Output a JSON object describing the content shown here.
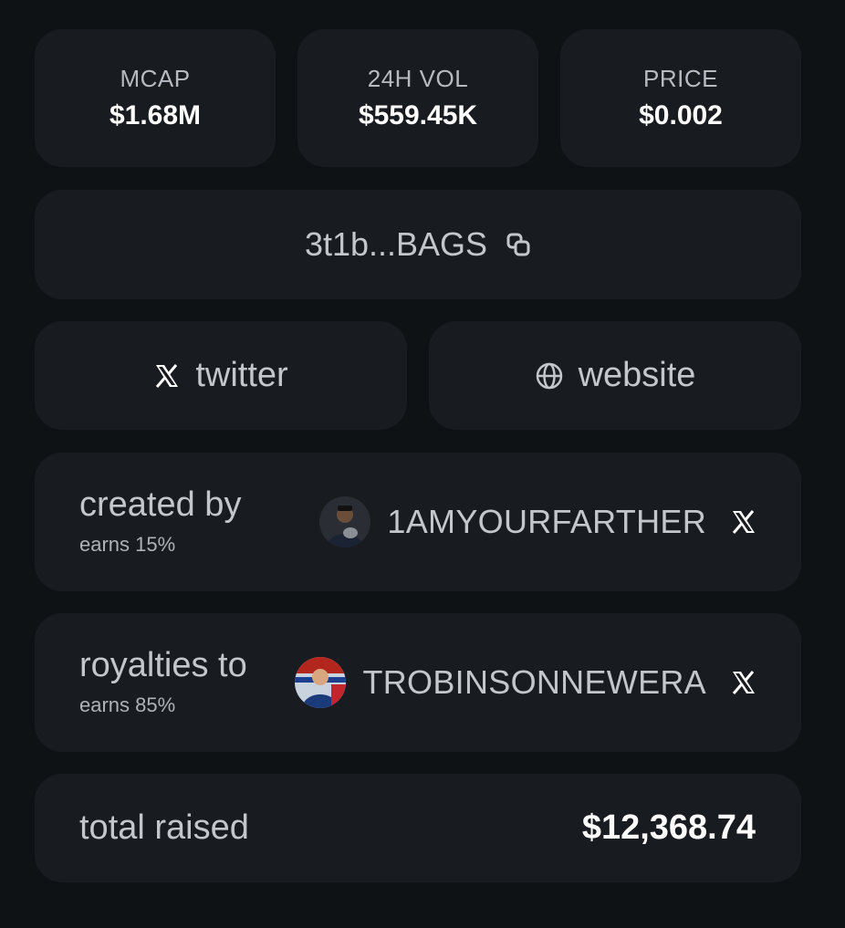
{
  "stats": [
    {
      "label": "MCAP",
      "value": "$1.68M"
    },
    {
      "label": "24H VOL",
      "value": "$559.45K"
    },
    {
      "label": "PRICE",
      "value": "$0.002"
    }
  ],
  "contract": {
    "address": "3t1b...BAGS",
    "icon": "copy-icon"
  },
  "links": {
    "twitter": {
      "label": "twitter",
      "icon": "x-logo-icon"
    },
    "website": {
      "label": "website",
      "icon": "globe-icon"
    }
  },
  "creator": {
    "title": "created by",
    "earns": "earns 15%",
    "handle": "1AMYOURFARTHER",
    "icon": "x-logo-icon"
  },
  "royalties": {
    "title": "royalties to",
    "earns": "earns 85%",
    "handle": "TROBINSONNEWERA",
    "icon": "x-logo-icon"
  },
  "total": {
    "label": "total raised",
    "value": "$12,368.74"
  },
  "colors": {
    "background": "#0f1215",
    "card": "#181b1f",
    "muted_text": "#c3c7cc",
    "text": "#ffffff"
  }
}
